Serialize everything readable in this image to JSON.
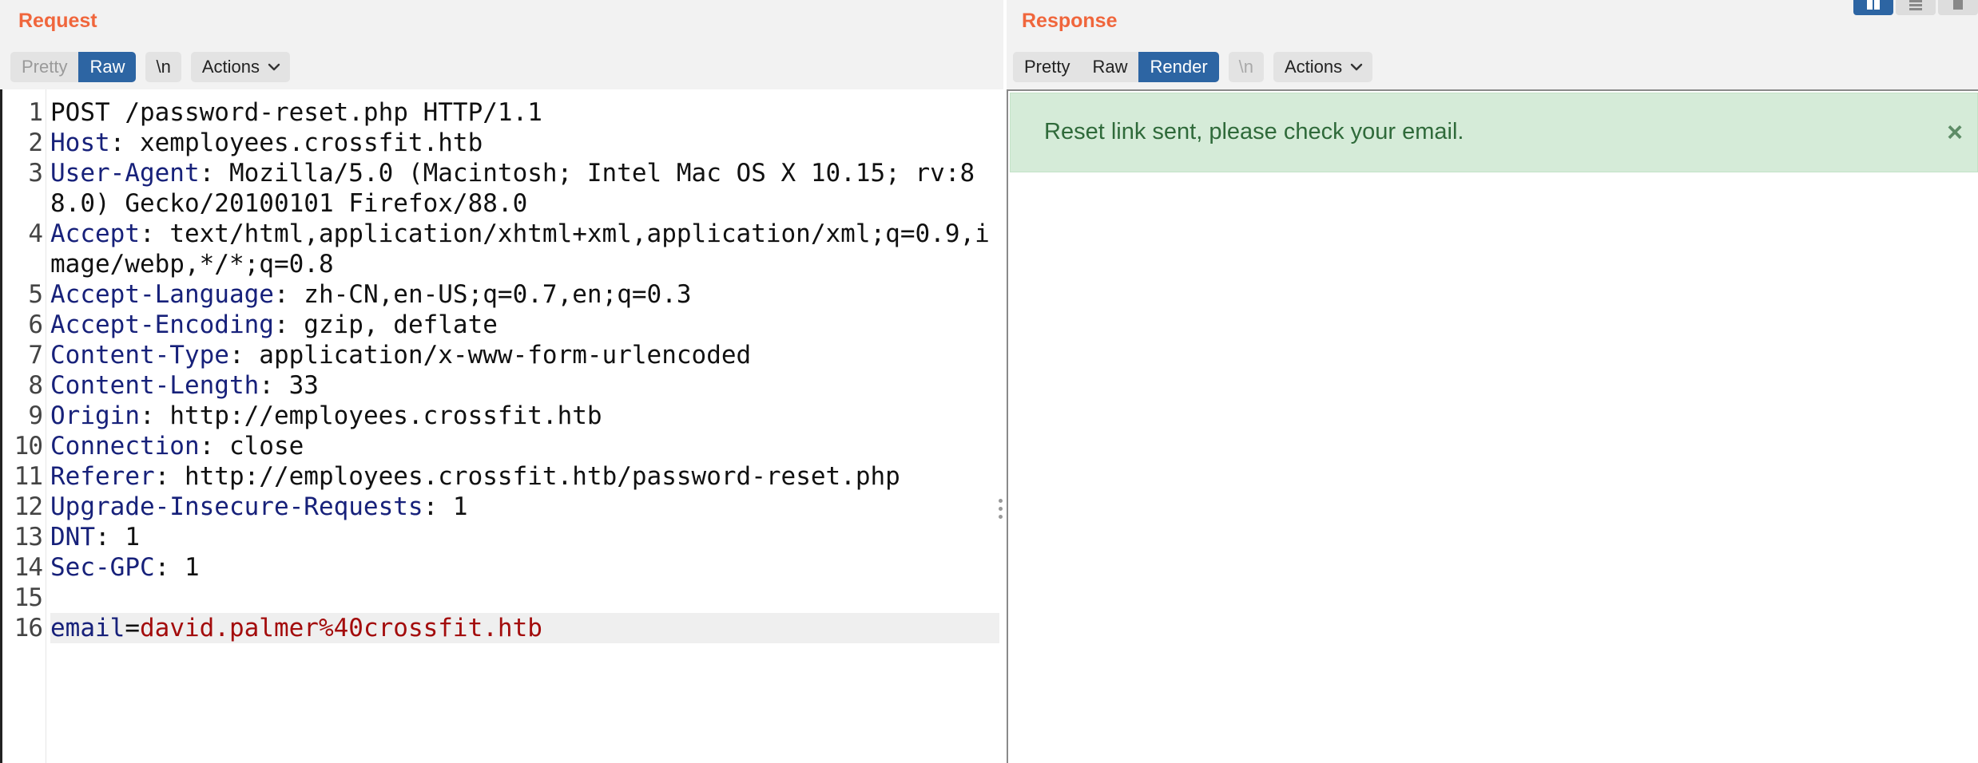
{
  "request": {
    "title": "Request",
    "tabs": [
      {
        "label": "Pretty",
        "state": "disabled"
      },
      {
        "label": "Raw",
        "state": "active"
      }
    ],
    "newline_label": "\\n",
    "actions_label": "Actions",
    "lines": [
      {
        "n": "1",
        "text": "POST /password-reset.php HTTP/1.1"
      },
      {
        "n": "2",
        "key": "Host",
        "value": "xemployees.crossfit.htb"
      },
      {
        "n": "3",
        "key": "User-Agent",
        "value": "Mozilla/5.0 (Macintosh; Intel Mac OS X 10.15; rv:88.0) Gecko/20100101 Firefox/88.0"
      },
      {
        "n": "4",
        "key": "Accept",
        "value": "text/html,application/xhtml+xml,application/xml;q=0.9,image/webp,*/*;q=0.8"
      },
      {
        "n": "5",
        "key": "Accept-Language",
        "value": "zh-CN,en-US;q=0.7,en;q=0.3"
      },
      {
        "n": "6",
        "key": "Accept-Encoding",
        "value": "gzip, deflate"
      },
      {
        "n": "7",
        "key": "Content-Type",
        "value": "application/x-www-form-urlencoded"
      },
      {
        "n": "8",
        "key": "Content-Length",
        "value": "33"
      },
      {
        "n": "9",
        "key": "Origin",
        "value": "http://employees.crossfit.htb"
      },
      {
        "n": "10",
        "key": "Connection",
        "value": "close"
      },
      {
        "n": "11",
        "key": "Referer",
        "value": "http://employees.crossfit.htb/password-reset.php"
      },
      {
        "n": "12",
        "key": "Upgrade-Insecure-Requests",
        "value": "1"
      },
      {
        "n": "13",
        "key": "DNT",
        "value": "1"
      },
      {
        "n": "14",
        "key": "Sec-GPC",
        "value": "1"
      },
      {
        "n": "15",
        "text": ""
      }
    ],
    "body_line": {
      "n": "16",
      "param": "email",
      "value": "david.palmer%40crossfit.htb"
    }
  },
  "response": {
    "title": "Response",
    "tabs": [
      {
        "label": "Pretty",
        "state": "normal"
      },
      {
        "label": "Raw",
        "state": "normal"
      },
      {
        "label": "Render",
        "state": "active"
      }
    ],
    "newline_label": "\\n",
    "actions_label": "Actions",
    "alert_message": "Reset link sent, please check your email.",
    "alert_close": "×"
  },
  "colors": {
    "accent": "#f0663c",
    "active_tab": "#2d65a3",
    "header_key": "#17217a",
    "param_value": "#a30c0c",
    "alert_bg": "#d5ebd8",
    "alert_text": "#2f6a3a"
  },
  "icons": {
    "actions_chevron": "chevron-down-icon",
    "alert_close": "close-icon",
    "layout_toggle": [
      "layout-side-by-side-icon",
      "layout-stacked-icon",
      "layout-tabs-icon"
    ]
  }
}
